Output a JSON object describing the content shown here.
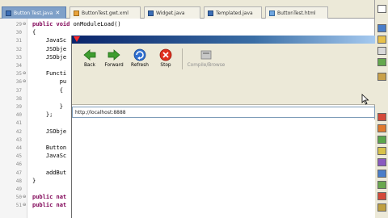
{
  "tabs": [
    {
      "label": "Button Test.java",
      "active": true
    },
    {
      "label": "ButtonTest.gwt.xml",
      "active": false
    },
    {
      "label": "Widget.java",
      "active": false
    },
    {
      "label": "Templated.java",
      "active": false
    },
    {
      "label": "ButtonTest.html",
      "active": false
    }
  ],
  "editor": {
    "line_numbers": [
      "29",
      "30",
      "31",
      "32",
      "33",
      "34",
      "35",
      "36",
      "37",
      "38",
      "39",
      "40",
      "41",
      "42",
      "43",
      "44",
      "45",
      "46",
      "47",
      "48",
      "49",
      "50",
      "51"
    ],
    "lines": [
      {
        "pre": "",
        "kw": "public void",
        "rest": " onModuleLoad()"
      },
      {
        "pre": "",
        "kw": "",
        "rest": "{"
      },
      {
        "pre": "    ",
        "kw": "",
        "rest": "JavaSc"
      },
      {
        "pre": "    ",
        "kw": "",
        "rest": "JSObje"
      },
      {
        "pre": "    ",
        "kw": "",
        "rest": "JSObje"
      },
      {
        "pre": "",
        "kw": "",
        "rest": ""
      },
      {
        "pre": "    ",
        "kw": "",
        "rest": "Functi"
      },
      {
        "pre": "        ",
        "kw": "",
        "rest": "pu"
      },
      {
        "pre": "        ",
        "kw": "",
        "rest": "{"
      },
      {
        "pre": "",
        "kw": "",
        "rest": ""
      },
      {
        "pre": "        ",
        "kw": "",
        "rest": "}"
      },
      {
        "pre": "    ",
        "kw": "",
        "rest": "};"
      },
      {
        "pre": "",
        "kw": "",
        "rest": ""
      },
      {
        "pre": "    ",
        "kw": "",
        "rest": "JSObje"
      },
      {
        "pre": "",
        "kw": "",
        "rest": ""
      },
      {
        "pre": "    ",
        "kw": "",
        "rest": "Button"
      },
      {
        "pre": "    ",
        "kw": "",
        "rest": "JavaSc"
      },
      {
        "pre": "",
        "kw": "",
        "rest": ""
      },
      {
        "pre": "    ",
        "kw": "",
        "rest": "addBut"
      },
      {
        "pre": "",
        "kw": "",
        "rest": "}"
      },
      {
        "pre": "",
        "kw": "",
        "rest": ""
      },
      {
        "pre": "",
        "kw": "public nat",
        "rest": ""
      },
      {
        "pre": "",
        "kw": "public nat",
        "rest": ""
      }
    ]
  },
  "browser": {
    "toolbar": {
      "back_label": "Back",
      "forward_label": "Forward",
      "refresh_label": "Refresh",
      "stop_label": "Stop",
      "compile_label": "Compile/Browse"
    },
    "url": "http://localhost:8888"
  },
  "colors": {
    "back_arrow": "#3f9d2f",
    "forward_arrow": "#3f9d2f",
    "refresh": "#2f6fd0",
    "stop": "#e0301e",
    "title_gradient_start": "#0a246a",
    "keyword": "#7f0055"
  }
}
